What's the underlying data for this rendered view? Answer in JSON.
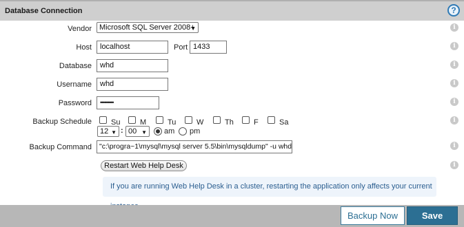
{
  "header": {
    "title": "Database Connection",
    "help_symbol": "?"
  },
  "info_symbol": "i",
  "form": {
    "vendor": {
      "label": "Vendor",
      "value": "Microsoft SQL Server 2008+"
    },
    "host": {
      "label": "Host",
      "value": "localhost"
    },
    "port": {
      "label": "Port",
      "value": "1433"
    },
    "database": {
      "label": "Database",
      "value": "whd"
    },
    "username": {
      "label": "Username",
      "value": "whd"
    },
    "password": {
      "label": "Password",
      "value": "•••••••••"
    },
    "backup_schedule": {
      "label": "Backup Schedule",
      "days": [
        "Su",
        "M",
        "Tu",
        "W",
        "Th",
        "F",
        "Sa"
      ],
      "hour": "12",
      "time_separator": ":",
      "minute": "00",
      "am_label": "am",
      "pm_label": "pm",
      "selected_meridiem": "am"
    },
    "backup_command": {
      "label": "Backup Command",
      "value": "\"c:\\progra~1\\mysql\\mysql server 5.5\\bin\\mysqldump\" -u whd -p"
    }
  },
  "restart_button": "Restart Web Help Desk",
  "note": "If you are running Web Help Desk in a cluster, restarting the application only affects your current instance.",
  "footer": {
    "backup_now": "Backup Now",
    "save": "Save"
  },
  "colors": {
    "accent": "#2c6f93",
    "header_bg": "#cfcfcf",
    "footer_bg": "#b7b7b7",
    "note_bg": "#eef4fb"
  }
}
